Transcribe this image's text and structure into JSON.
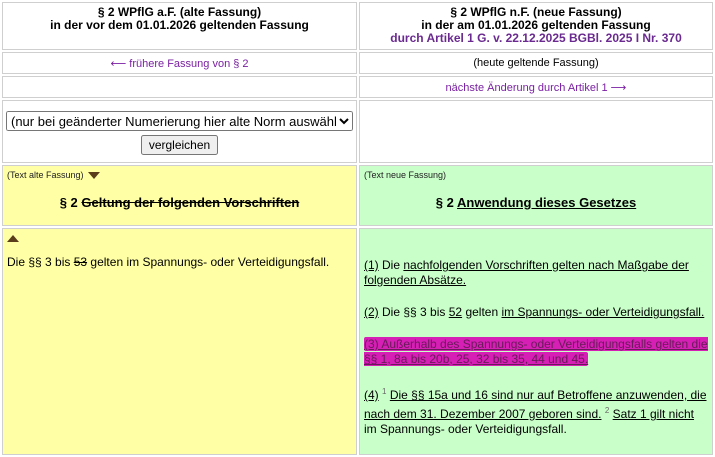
{
  "header": {
    "left_line1": "§ 2 WPflG a.F. (alte Fassung)",
    "left_line2": "in der vor dem 01.01.2026 geltenden Fassung",
    "right_line1": "§ 2 WPflG n.F. (neue Fassung)",
    "right_line2": "in der am 01.01.2026 geltenden Fassung",
    "right_line3": "durch Artikel 1 G. v. 22.12.2025 BGBl. 2025 I Nr. 370"
  },
  "nav": {
    "prev_arrow": "⟵",
    "prev_label": "frühere Fassung von § 2",
    "current_label": "(heute geltende Fassung)",
    "next_label": "nächste Änderung durch Artikel 1",
    "next_arrow": "⟶"
  },
  "compare": {
    "select_value": "(nur bei geänderter Numerierung hier alte Norm auswählen!)",
    "button_label": "vergleichen"
  },
  "old": {
    "label": "(Text alte Fassung)",
    "title_num": "§ 2",
    "title_struck": "Geltung der folgenden Vorschriften",
    "text_a": "Die §§ 3 bis",
    "text_struck": "53",
    "text_b": "gelten im Spannungs- oder Verteidigungsfall."
  },
  "new": {
    "label": "(Text neue Fassung)",
    "title_num": "§ 2",
    "title_text": "Anwendung dieses Gesetzes",
    "p1_num": "(1)",
    "p1_a": "Die",
    "p1_b": "nachfolgenden Vorschriften gelten nach Maßgabe der folgenden Absätze.",
    "p2_num": "(2)",
    "p2_a": "Die §§ 3 bis",
    "p2_b": "52",
    "p2_c": "gelten",
    "p2_d": "im Spannungs- oder Verteidigungsfall.",
    "p3": "(3) Außerhalb des Spannungs- oder Verteidigungsfalls gelten die §§ 1, 8a bis 20b, 25, 32 bis 35, 44 und 45.",
    "p4_num": "(4)",
    "p4_s1": "1",
    "p4_a": "Die §§ 15a und 16 sind nur auf Betroffene anzuwenden, die nach dem 31. Dezember 2007 geboren sind.",
    "p4_s2": "2",
    "p4_b": "Satz 1 gilt nicht",
    "p4_c": "im Spannungs- oder Verteidigungsfall."
  }
}
